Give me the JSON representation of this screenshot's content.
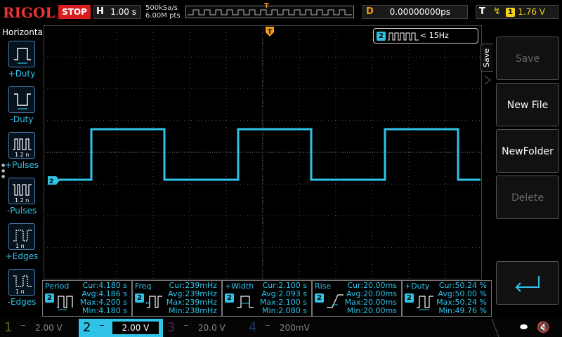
{
  "topbar": {
    "logo": "RIGOL",
    "run_state": "STOP",
    "timebase_label": "H",
    "timebase_value": "1.00 s",
    "sample_rate": "500kSa/s",
    "memory_depth": "6.00M pts",
    "delay_label": "D",
    "delay_value": "0.00000000ps",
    "trigger_label": "T",
    "trigger_channel": "1",
    "trigger_level": "1.76 V"
  },
  "left_panel": {
    "title": "Horizontal",
    "items": [
      {
        "label": "+Duty",
        "icon": "positive-duty-icon"
      },
      {
        "label": "-Duty",
        "icon": "negative-duty-icon"
      },
      {
        "label": "+Pulses",
        "icon": "positive-pulses-icon"
      },
      {
        "label": "-Pulses",
        "icon": "negative-pulses-icon"
      },
      {
        "label": "+Edges",
        "icon": "positive-edges-icon"
      },
      {
        "label": "-Edges",
        "icon": "negative-edges-icon"
      }
    ]
  },
  "signal_tag": {
    "channel": "2",
    "text": "< 15Hz"
  },
  "channel_marker": "2",
  "right_panel": {
    "tab": "Save",
    "buttons": [
      {
        "label": "Save",
        "enabled": false
      },
      {
        "label": "New File",
        "enabled": true
      },
      {
        "label": "NewFolder",
        "enabled": true
      },
      {
        "label": "Delete",
        "enabled": false
      }
    ]
  },
  "measurements": [
    {
      "name": "Period",
      "channel": "2",
      "cur": "Cur:4.180 s",
      "avg": "Avg:4.186 s",
      "max": "Max:4.200 s",
      "min": "Min:4.180 s"
    },
    {
      "name": "Freq",
      "channel": "2",
      "cur": "Cur:239mHz",
      "avg": "Avg:239mHz",
      "max": "Max:239mHz",
      "min": "Min:238mHz"
    },
    {
      "name": "+Width",
      "channel": "2",
      "cur": "Cur:2.100 s",
      "avg": "Avg:2.093 s",
      "max": "Max:2.100 s",
      "min": "Min:2.080 s"
    },
    {
      "name": "Rise",
      "channel": "2",
      "cur": "Cur:20.00ms",
      "avg": "Avg:20.00ms",
      "max": "Max:20.00ms",
      "min": "Min:20.00ms"
    },
    {
      "name": "+Duty",
      "channel": "2",
      "cur": "Cur:50.24 %",
      "avg": "Avg:50.00 %",
      "max": "Max:50.24 %",
      "min": "Min:49.76 %"
    }
  ],
  "bottombar": {
    "channels": [
      {
        "num": "1",
        "scale": "2.00 V",
        "color": "#f4d01a"
      },
      {
        "num": "2",
        "scale": "2.00 V",
        "color": "#2fc3e8"
      },
      {
        "num": "3",
        "scale": "20.0 V",
        "color": "#d23fd2"
      },
      {
        "num": "4",
        "scale": "200mV",
        "color": "#2a6ae0"
      }
    ]
  },
  "colors": {
    "trace": "#2fc3e8",
    "trigger": "#f49a1a",
    "accent_red": "#d81e1e"
  }
}
